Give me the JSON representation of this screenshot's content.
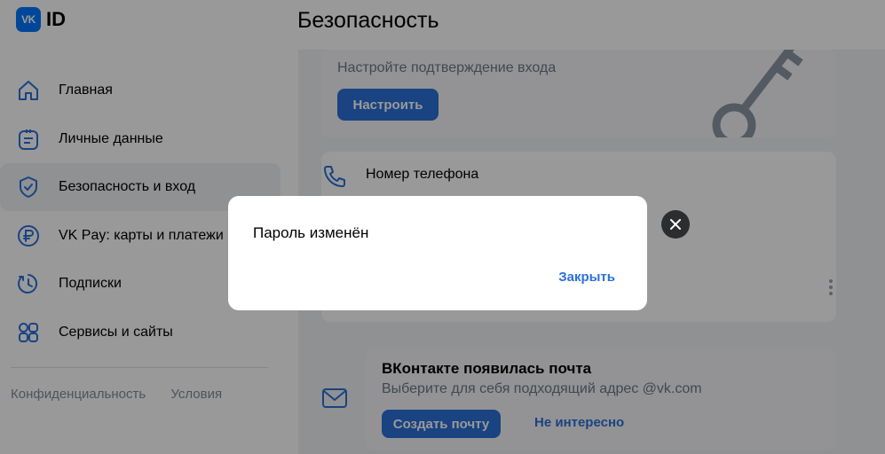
{
  "header": {
    "logo_mark": "VK",
    "logo_text": "ID",
    "title": "Безопасность"
  },
  "sidebar": {
    "items": [
      {
        "label": "Главная",
        "icon": "home-icon"
      },
      {
        "label": "Личные данные",
        "icon": "profile-card-icon"
      },
      {
        "label": "Безопасность и вход",
        "icon": "shield-icon",
        "active": true
      },
      {
        "label": "VK Pay: карты и платежи",
        "icon": "ruble-icon"
      },
      {
        "label": "Подписки",
        "icon": "subscriptions-icon"
      },
      {
        "label": "Сервисы и сайты",
        "icon": "services-grid-icon"
      }
    ],
    "footer": {
      "privacy": "Конфиденциальность",
      "terms": "Условия"
    }
  },
  "main": {
    "promo": {
      "subtitle": "Настройте подтверждение входа",
      "button": "Настроить"
    },
    "phone": {
      "label": "Номер телефона"
    },
    "mail": {
      "title": "ВКонтакте появилась почта",
      "subtitle": "Выберите для себя подходящий адрес @vk.com",
      "create_button": "Создать почту",
      "not_interested": "Не интересно"
    }
  },
  "dialog": {
    "message": "Пароль изменён",
    "close_link": "Закрыть"
  },
  "colors": {
    "accent": "#2b71d8",
    "brand": "#0077ff",
    "overlay": "rgba(0,0,0,0.4)"
  }
}
